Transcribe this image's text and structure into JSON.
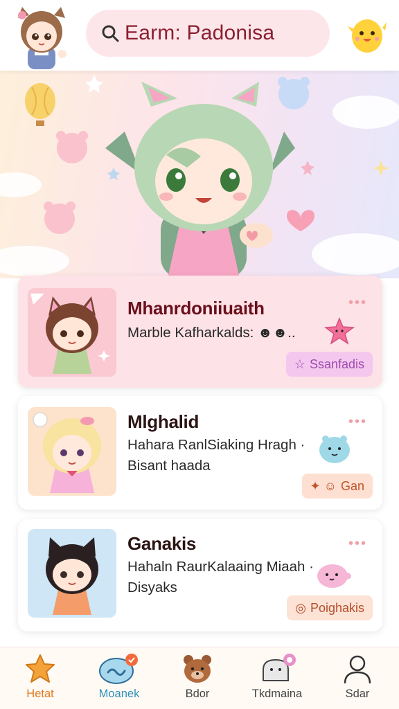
{
  "header": {
    "search_text": "Earm: Padonisa",
    "avatar_icon": "chibi-girl-avatar-icon",
    "mascot_icon": "yellow-chick-icon"
  },
  "hero": {
    "character": "green-haired-cat-girl",
    "decorations": [
      "hot-air-balloon",
      "bear-face-balloons",
      "heart",
      "stars",
      "clouds"
    ]
  },
  "cards": [
    {
      "title": "Mhanrdoniiuaith",
      "description_lines": [
        "Marble Kafharkalds: ☻☻.."
      ],
      "dots": "•••",
      "tag_icon": "☆",
      "tag_label": "Ssanfadis",
      "sticker": "pink-star-sticker",
      "tag_color": "#f4c8ee",
      "tag_text_color": "#a04ab0"
    },
    {
      "title": "Mlghalid",
      "description_lines": [
        "Hahara RanlSiaking Hragh ·",
        "Bisant haada"
      ],
      "dots": "•••",
      "tag_icon": "✦ ☺",
      "tag_label": "Gan",
      "sticker": "blue-blob-sticker",
      "tag_color": "#fde0d2",
      "tag_text_color": "#c0552a"
    },
    {
      "title": "Ganakis",
      "description_lines": [
        "Hahaln RaurKalaaing Miaah ·",
        "Disyaks"
      ],
      "dots": "•••",
      "tag_icon": "◎",
      "tag_label": "Poighakis",
      "sticker": "pink-blob-sticker",
      "tag_color": "#fde2d6",
      "tag_text_color": "#b4502a"
    }
  ],
  "bottom_nav": [
    {
      "label": "Hetat",
      "icon": "star-icon",
      "color": "#e0791f"
    },
    {
      "label": "Moanek",
      "icon": "chat-bubble-icon",
      "color": "#2f8fb8"
    },
    {
      "label": "Bdor",
      "icon": "bear-icon",
      "color": "#444444"
    },
    {
      "label": "Tkdmaina",
      "icon": "ghost-icon",
      "color": "#444444"
    },
    {
      "label": "Sdar",
      "icon": "profile-icon",
      "color": "#444444"
    }
  ]
}
